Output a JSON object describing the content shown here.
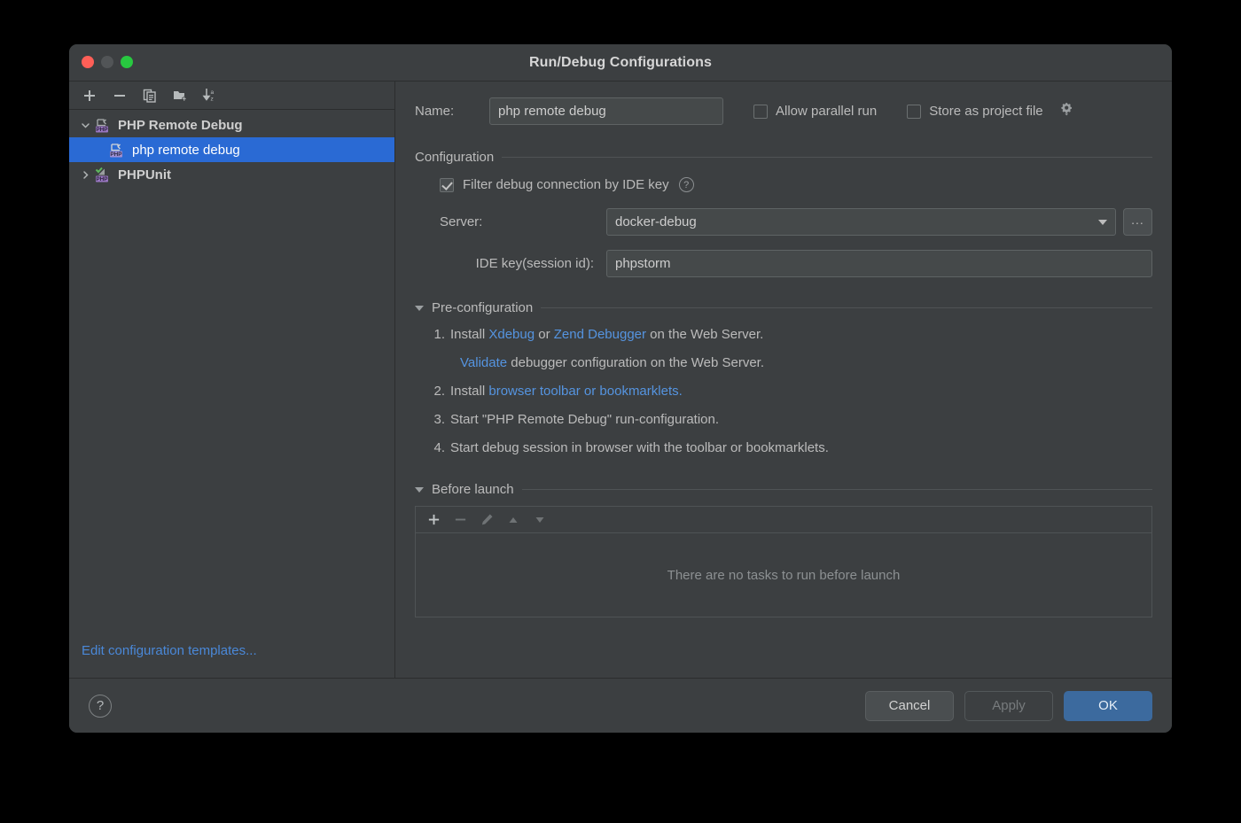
{
  "window": {
    "title": "Run/Debug Configurations",
    "traffic_lights": [
      "close-red",
      "minimize-grey",
      "maximize-green"
    ]
  },
  "sidebar": {
    "toolbar": [
      {
        "name": "add",
        "icon": "plus-icon",
        "label": "+"
      },
      {
        "name": "remove",
        "icon": "minus-icon",
        "label": "−"
      },
      {
        "name": "copy",
        "icon": "copy-icon",
        "label": "Copy Configuration"
      },
      {
        "name": "new-folder",
        "icon": "new-folder-icon",
        "label": "Create New Folder"
      },
      {
        "name": "sort",
        "icon": "sort-az-icon",
        "label": "Sort Configurations"
      }
    ],
    "tree": [
      {
        "label": "PHP Remote Debug",
        "type": "group",
        "expanded": true,
        "selected": false,
        "icon": "php-remote-debug-icon"
      },
      {
        "label": "php remote debug",
        "type": "child",
        "expanded": false,
        "selected": true,
        "icon": "php-remote-debug-icon"
      },
      {
        "label": "PHPUnit",
        "type": "group",
        "expanded": false,
        "selected": false,
        "icon": "phpunit-icon"
      }
    ],
    "edit_templates_label": "Edit configuration templates..."
  },
  "main": {
    "name_label": "Name:",
    "name_value": "php remote debug",
    "allow_parallel_run": {
      "label": "Allow parallel run",
      "checked": false
    },
    "store_as_project_file": {
      "label": "Store as project file",
      "checked": false,
      "gear_icon": "gear-dropdown-icon"
    },
    "configuration": {
      "section_label": "Configuration",
      "filter_debug": {
        "label": "Filter debug connection by IDE key",
        "checked": true,
        "help_icon": "question-circle-icon",
        "help_glyph": "?"
      },
      "server": {
        "label": "Server:",
        "value": "docker-debug",
        "browse_label": "..."
      },
      "ide_key": {
        "label": "IDE key(session id):",
        "value": "phpstorm"
      }
    },
    "preconfiguration": {
      "section_label": "Pre-configuration",
      "steps": [
        {
          "num": "1.",
          "parts": [
            {
              "t": "Install ",
              "link": false
            },
            {
              "t": "Xdebug",
              "link": true
            },
            {
              "t": " or ",
              "link": false
            },
            {
              "t": "Zend Debugger",
              "link": true
            },
            {
              "t": " on the Web Server.",
              "link": false
            }
          ]
        },
        {
          "num": "",
          "parts": [
            {
              "t": "Validate",
              "link": true
            },
            {
              "t": " debugger configuration on the Web Server.",
              "link": false
            }
          ]
        },
        {
          "num": "2.",
          "parts": [
            {
              "t": "Install ",
              "link": false
            },
            {
              "t": "browser toolbar or bookmarklets.",
              "link": true
            }
          ]
        },
        {
          "num": "3.",
          "parts": [
            {
              "t": "Start \"PHP Remote Debug\" run-configuration.",
              "link": false
            }
          ]
        },
        {
          "num": "4.",
          "parts": [
            {
              "t": "Start debug session in browser with the toolbar or bookmarklets.",
              "link": false
            }
          ]
        }
      ]
    },
    "before_launch": {
      "section_label": "Before launch",
      "toolbar": [
        {
          "name": "add-task",
          "icon": "plus-icon",
          "enabled": true
        },
        {
          "name": "remove-task",
          "icon": "minus-icon",
          "enabled": false
        },
        {
          "name": "edit-task",
          "icon": "pencil-icon",
          "enabled": false
        },
        {
          "name": "move-up-task",
          "icon": "arrow-up-icon",
          "enabled": false
        },
        {
          "name": "move-down-task",
          "icon": "arrow-down-icon",
          "enabled": false
        }
      ],
      "empty_text": "There are no tasks to run before launch"
    }
  },
  "footer": {
    "help_glyph": "?",
    "cancel_label": "Cancel",
    "apply_label": "Apply",
    "apply_enabled": false,
    "ok_label": "OK"
  },
  "colors": {
    "window_bg": "#3c3f41",
    "selection_blue": "#2a6ad4",
    "link_blue": "#5594e0",
    "primary_button": "#3c6a9e",
    "text": "#bbbbbb",
    "php_badge_purple": "#9876c0"
  }
}
